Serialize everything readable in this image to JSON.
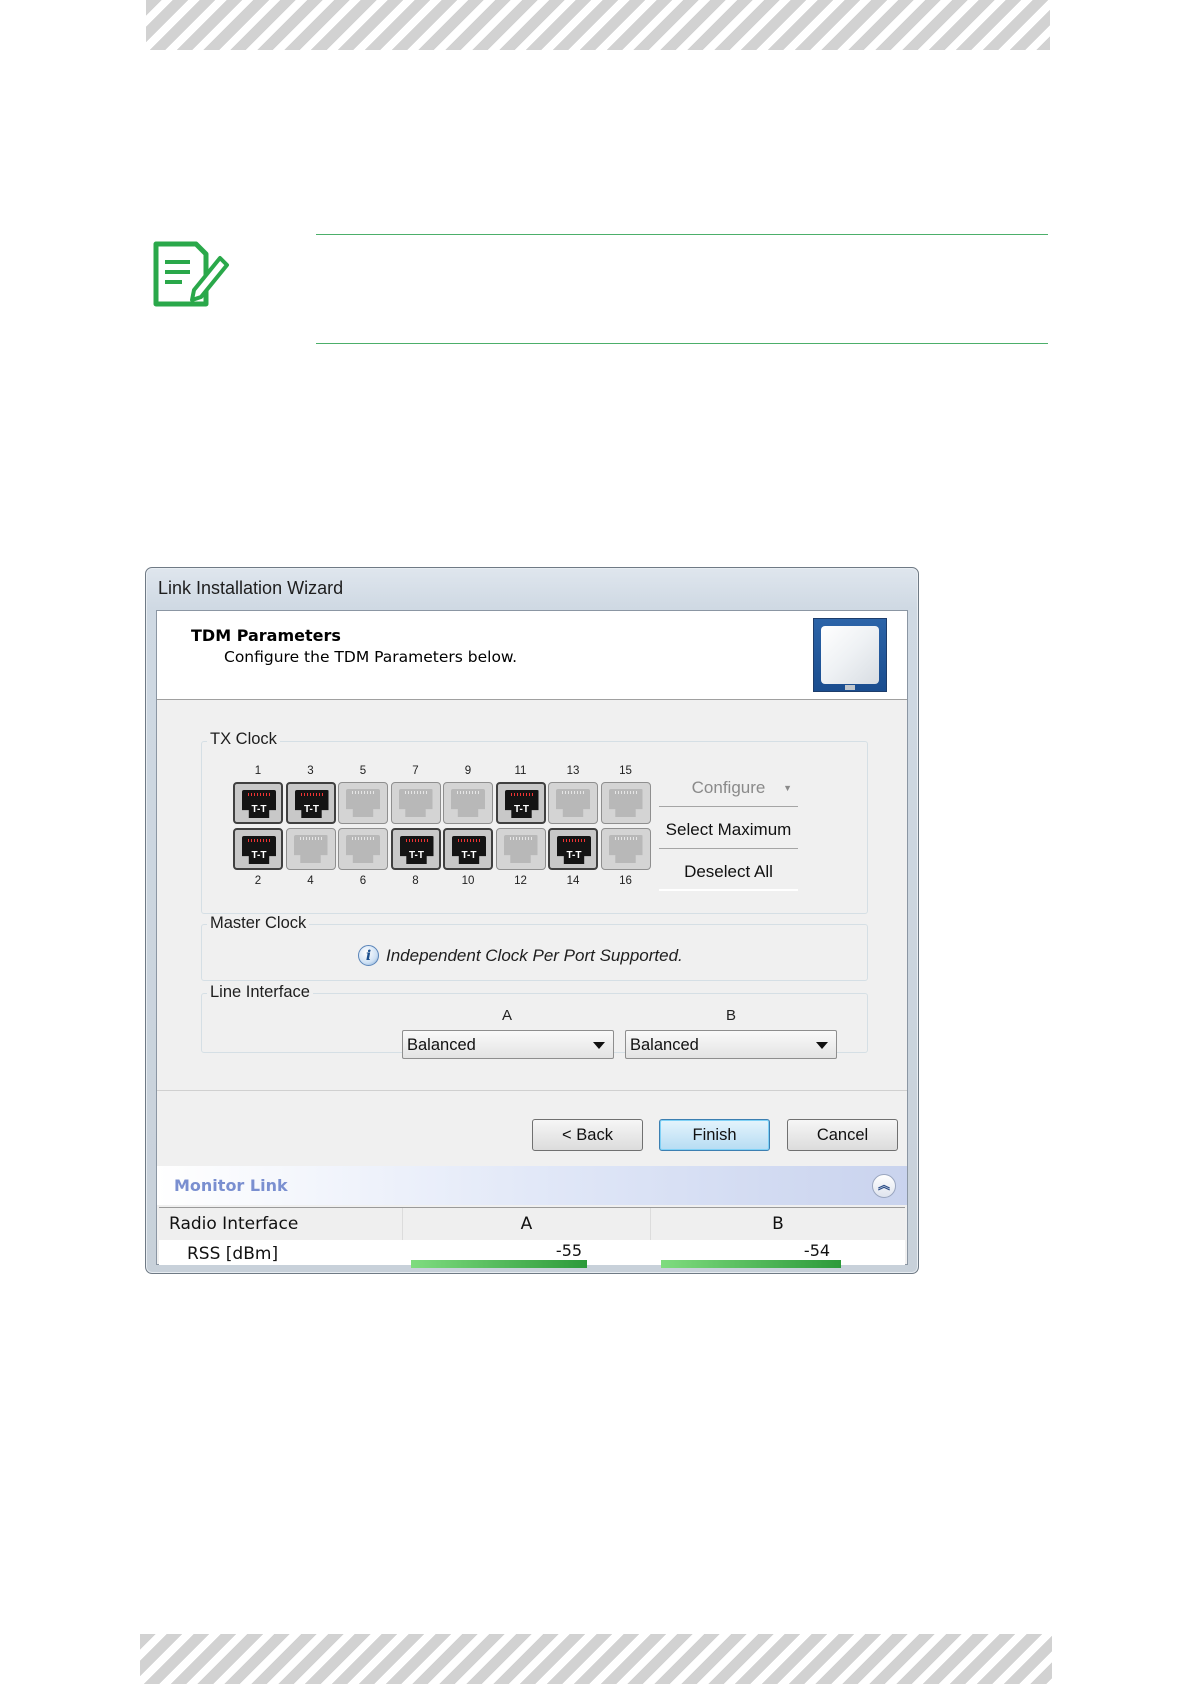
{
  "wizard": {
    "window_title": "Link Installation Wizard",
    "header_title": "TDM Parameters",
    "header_subtitle": "Configure the TDM Parameters below."
  },
  "tx_clock": {
    "label": "TX Clock",
    "ports": [
      {
        "num": "1",
        "selected": true,
        "badge": "T-T"
      },
      {
        "num": "2",
        "selected": true,
        "badge": "T-T"
      },
      {
        "num": "3",
        "selected": true,
        "badge": "T-T"
      },
      {
        "num": "4",
        "selected": false,
        "badge": ""
      },
      {
        "num": "5",
        "selected": false,
        "badge": ""
      },
      {
        "num": "6",
        "selected": false,
        "badge": ""
      },
      {
        "num": "7",
        "selected": false,
        "badge": ""
      },
      {
        "num": "8",
        "selected": true,
        "badge": "T-T"
      },
      {
        "num": "9",
        "selected": false,
        "badge": ""
      },
      {
        "num": "10",
        "selected": true,
        "badge": "T-T"
      },
      {
        "num": "11",
        "selected": true,
        "badge": "T-T"
      },
      {
        "num": "12",
        "selected": false,
        "badge": ""
      },
      {
        "num": "13",
        "selected": false,
        "badge": ""
      },
      {
        "num": "14",
        "selected": true,
        "badge": "T-T"
      },
      {
        "num": "15",
        "selected": false,
        "badge": ""
      },
      {
        "num": "16",
        "selected": false,
        "badge": ""
      }
    ],
    "configure_label": "Configure",
    "select_max_label": "Select Maximum",
    "deselect_label": "Deselect All"
  },
  "master_clock": {
    "label": "Master Clock",
    "message": "Independent Clock Per Port Supported."
  },
  "line_interface": {
    "label": "Line Interface",
    "col_a": "A",
    "col_b": "B",
    "value_a": "Balanced",
    "value_b": "Balanced"
  },
  "buttons": {
    "back": "< Back",
    "finish": "Finish",
    "cancel": "Cancel"
  },
  "monitor": {
    "title": "Monitor Link",
    "header_col": "Radio Interface",
    "col_a": "A",
    "col_b": "B",
    "row_label": "RSS [dBm]",
    "rss_a": "-55",
    "rss_b": "-54"
  },
  "colors": {
    "note_icon": "#2aa84a",
    "note_rule": "#4caf6a",
    "rss_bar": "#2c9a3a",
    "monitor_title": "#7a8fd0"
  }
}
